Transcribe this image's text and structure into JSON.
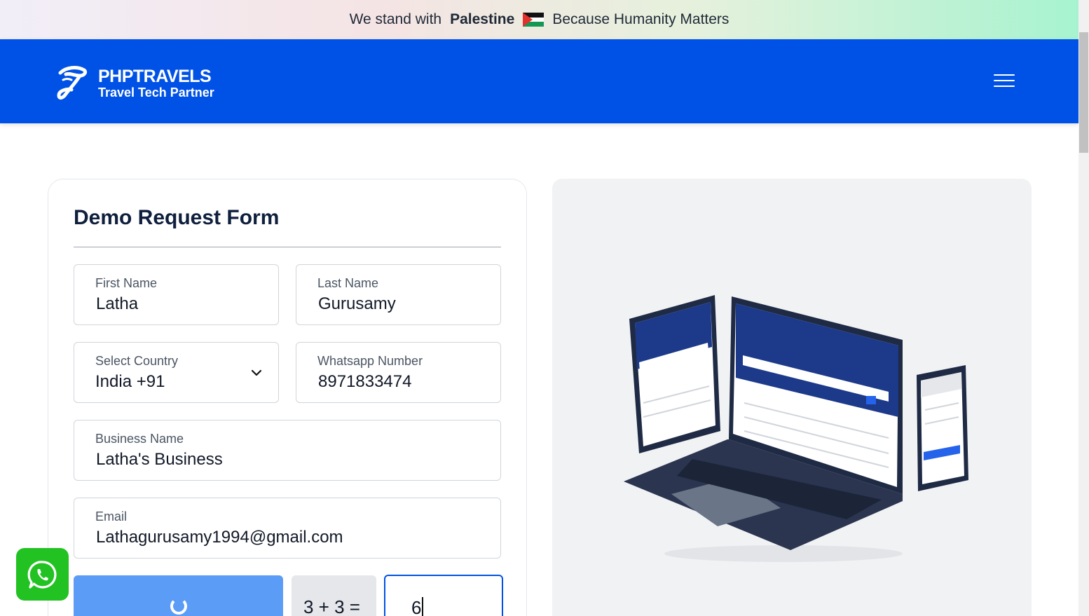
{
  "banner": {
    "text_before": "We stand with",
    "bold": "Palestine",
    "text_after": "Because Humanity Matters"
  },
  "header": {
    "logo_title": "PHPTRAVELS",
    "logo_subtitle": "Travel Tech Partner",
    "menu_icon": "hamburger-menu-icon",
    "bg_color": "#0052e6"
  },
  "form": {
    "title": "Demo Request Form",
    "first_name": {
      "label": "First Name",
      "value": "Latha"
    },
    "last_name": {
      "label": "Last Name",
      "value": "Gurusamy"
    },
    "country": {
      "label": "Select Country",
      "value": "India +91"
    },
    "whatsapp": {
      "label": "Whatsapp Number",
      "value": "8971833474"
    },
    "business": {
      "label": "Business Name",
      "value": "Latha's Business"
    },
    "email": {
      "label": "Email",
      "value": "Lathagurusamy1994@gmail.com"
    },
    "captcha": {
      "question": "3 + 3 =",
      "answer": "6"
    }
  },
  "colors": {
    "primary": "#0052e6",
    "captcha_button": "#5b9cf6",
    "whatsapp": "#22c222"
  }
}
